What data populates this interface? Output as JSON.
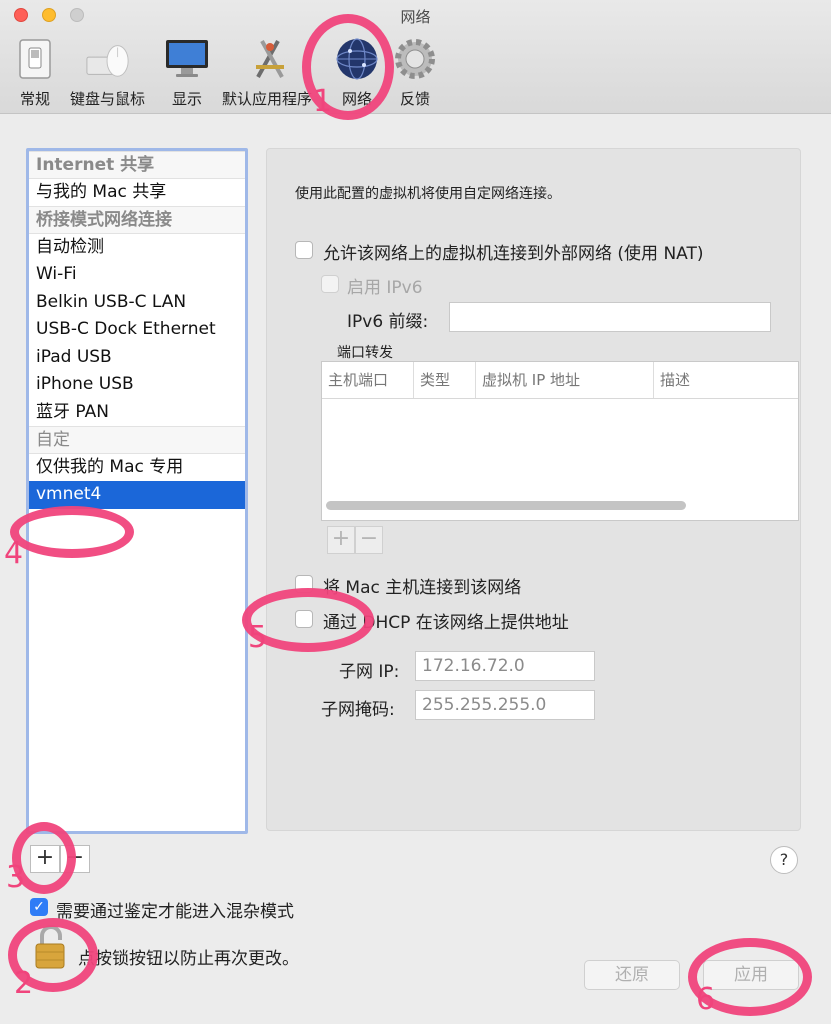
{
  "window": {
    "title": "网络"
  },
  "toolbar": {
    "items": [
      {
        "label": "常规",
        "icon": "switch-icon"
      },
      {
        "label": "键盘与鼠标",
        "icon": "keyboard-mouse-icon"
      },
      {
        "label": "显示",
        "icon": "monitor-icon"
      },
      {
        "label": "默认应用程序",
        "icon": "app-tools-icon"
      },
      {
        "label": "网络",
        "icon": "globe-icon"
      },
      {
        "label": "反馈",
        "icon": "gear-icon"
      }
    ]
  },
  "sidebar": {
    "items": [
      {
        "label": "Internet 共享",
        "type": "header"
      },
      {
        "label": "与我的 Mac 共享",
        "type": "item"
      },
      {
        "label": "桥接模式网络连接",
        "type": "header"
      },
      {
        "label": "自动检测",
        "type": "item"
      },
      {
        "label": "Wi-Fi",
        "type": "item"
      },
      {
        "label": "Belkin USB-C LAN",
        "type": "item"
      },
      {
        "label": "USB-C Dock Ethernet",
        "type": "item"
      },
      {
        "label": "iPad USB",
        "type": "item"
      },
      {
        "label": "iPhone USB",
        "type": "item"
      },
      {
        "label": "蓝牙 PAN",
        "type": "item"
      },
      {
        "label": "自定",
        "type": "header-plain"
      },
      {
        "label": "仅供我的 Mac 专用",
        "type": "item"
      },
      {
        "label": "vmnet4",
        "type": "selected"
      }
    ],
    "add_label": "+",
    "remove_label": "−"
  },
  "panel": {
    "intro": "使用此配置的虚拟机将使用自定网络连接。",
    "nat_label": "允许该网络上的虚拟机连接到外部网络 (使用 NAT)",
    "ipv6_label": "启用 IPv6",
    "ipv6_prefix_label": "IPv6 前缀:",
    "ipv6_prefix_value": "",
    "port_forward_label": "端口转发",
    "columns": [
      "主机端口",
      "类型",
      "虚拟机 IP 地址",
      "描述"
    ],
    "table_add": "+",
    "table_remove": "−",
    "connect_host_label": "将 Mac 主机连接到该网络",
    "dhcp_label": "通过 DHCP 在该网络上提供地址",
    "subnet_ip_label": "子网 IP:",
    "subnet_ip_value": "172.16.72.0",
    "subnet_mask_label": "子网掩码:",
    "subnet_mask_value": "255.255.255.0"
  },
  "footer": {
    "help_label": "?",
    "promiscuous_label": "需要通过鉴定才能进入混杂模式",
    "promiscuous_checked": true,
    "lock_text": "点按锁按钮以防止再次更改。",
    "revert_label": "还原",
    "apply_label": "应用"
  },
  "annotations": {
    "color": "#f0447c",
    "numbers": [
      "1",
      "2",
      "3",
      "4",
      "5",
      "6"
    ]
  }
}
